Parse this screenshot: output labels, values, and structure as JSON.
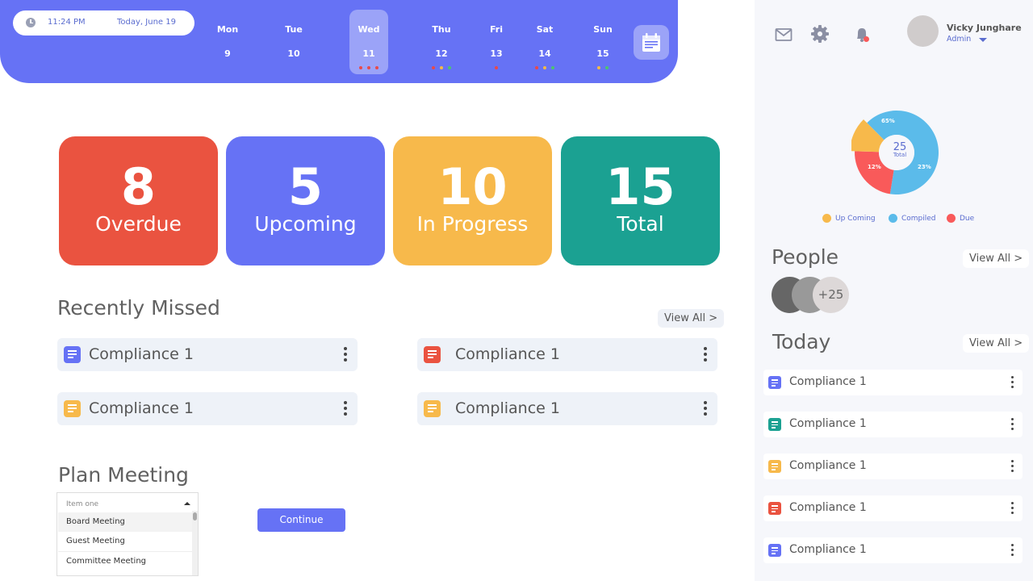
{
  "header": {
    "time": "11:24 PM",
    "date": "Today, June 19",
    "days": [
      {
        "name": "Mon",
        "num": "9"
      },
      {
        "name": "Tue",
        "num": "10"
      },
      {
        "name": "Wed",
        "num": "11"
      },
      {
        "name": "Thu",
        "num": "12"
      },
      {
        "name": "Fri",
        "num": "13"
      },
      {
        "name": "Sat",
        "num": "14"
      },
      {
        "name": "Sun",
        "num": "15"
      }
    ],
    "active_day": "Wed",
    "day_markers": {
      "Wed": [
        "#e84a4a",
        "#e84a4a",
        "#e84a4a"
      ],
      "Thu": [
        "#e84a4a",
        "#f5b945",
        "#4cc46f"
      ],
      "Fri": [
        "#e84a4a"
      ],
      "Sat": [
        "#e84a4a",
        "#f5b945",
        "#4cc46f"
      ],
      "Sun": [
        "#f5b945",
        "#4cc46f"
      ]
    }
  },
  "stats": [
    {
      "value": "8",
      "label": "Overdue",
      "color": "#ea5340"
    },
    {
      "value": "5",
      "label": "Upcoming",
      "color": "#6672f5"
    },
    {
      "value": "10",
      "label": "In Progress",
      "color": "#f7b94b"
    },
    {
      "value": "15",
      "label": "Total",
      "color": "#1ba192"
    }
  ],
  "recently_missed": {
    "title": "Recently Missed",
    "view_all": "View All >",
    "items": [
      {
        "label": "Compliance 1",
        "icon_color": "#6672f5"
      },
      {
        "label": "Compliance 1",
        "icon_color": "#ea5340"
      },
      {
        "label": "Compliance 1",
        "icon_color": "#f7b94b"
      },
      {
        "label": "Compliance 1",
        "icon_color": "#f7b94b"
      }
    ]
  },
  "plan_meeting": {
    "title": "Plan Meeting",
    "selected": "Item one",
    "options": [
      "Board Meeting",
      "Guest Meeting",
      "Committee Meeting"
    ],
    "continue_label": "Continue"
  },
  "user": {
    "name": "Vicky Junghare",
    "role": "Admin"
  },
  "summary_chart": {
    "total": "25",
    "total_label": "Total",
    "segments": [
      {
        "name": "Compiled",
        "percent": 65,
        "label": "65%",
        "color": "#5bbbea"
      },
      {
        "name": "Due",
        "percent": 23,
        "label": "23%",
        "color": "#f95a5a"
      },
      {
        "name": "Up Coming",
        "percent": 12,
        "label": "12%",
        "color": "#f7b94b"
      }
    ],
    "legend": [
      "Up Coming",
      "Compiled",
      "Due"
    ]
  },
  "people": {
    "title": "People",
    "view_all": "View All >",
    "more": "+25"
  },
  "today": {
    "title": "Today",
    "view_all": "View All >",
    "items": [
      {
        "label": "Compliance 1",
        "icon_color": "#6672f5"
      },
      {
        "label": "Compliance 1",
        "icon_color": "#1ba192"
      },
      {
        "label": "Compliance 1",
        "icon_color": "#f7b94b"
      },
      {
        "label": "Compliance 1",
        "icon_color": "#ea5340"
      },
      {
        "label": "Compliance 1",
        "icon_color": "#6672f5"
      }
    ]
  }
}
